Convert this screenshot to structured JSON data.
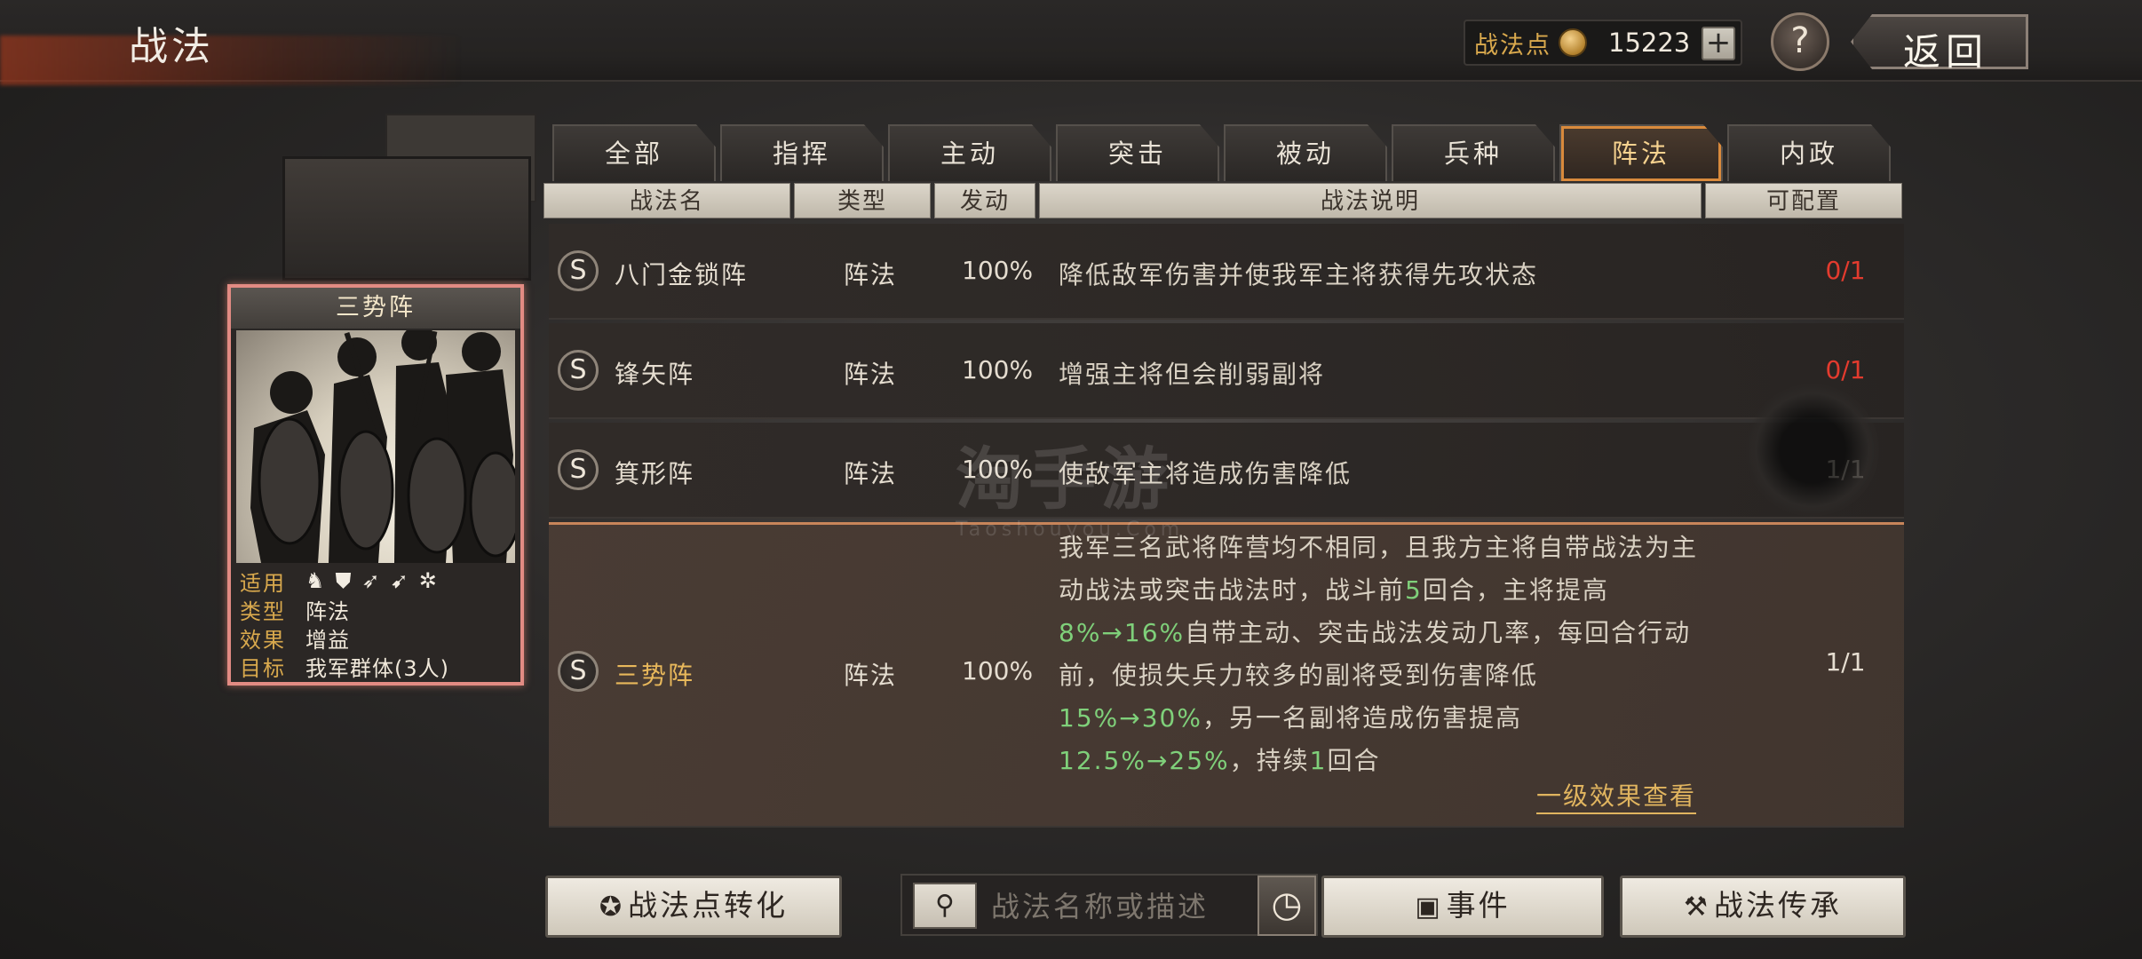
{
  "header": {
    "title": "战法",
    "points_label": "战法点",
    "points_value": "15223",
    "plus_label": "+",
    "help_label": "?",
    "back_label": "返回"
  },
  "card": {
    "name": "三势阵",
    "labels": {
      "apply": "适用",
      "type": "类型",
      "effect": "效果",
      "target": "目标"
    },
    "type": "阵法",
    "effect": "增益",
    "target": "我军群体(3人)",
    "troop_icons": [
      "cavalry-icon",
      "shield-icon",
      "bow-icon",
      "spear-icon",
      "vehicle-icon"
    ]
  },
  "tabs": [
    "全部",
    "指挥",
    "主动",
    "突击",
    "被动",
    "兵种",
    "阵法",
    "内政"
  ],
  "active_tab": "阵法",
  "table": {
    "headers": [
      "战法名",
      "类型",
      "发动",
      "战法说明",
      "可配置"
    ],
    "rows": [
      {
        "badge": "S",
        "name": "八门金锁阵",
        "type": "阵法",
        "rate": "100%",
        "desc": "降低敌军伤害并使我军主将获得先攻状态",
        "count": "0/1"
      },
      {
        "badge": "S",
        "name": "锋矢阵",
        "type": "阵法",
        "rate": "100%",
        "desc": "增强主将但会削弱副将",
        "count": "0/1"
      },
      {
        "badge": "S",
        "name": "箕形阵",
        "type": "阵法",
        "rate": "100%",
        "desc": "使敌军主将造成伤害降低",
        "count": "1/1"
      },
      {
        "badge": "S",
        "name": "三势阵",
        "type": "阵法",
        "rate": "100%",
        "count": "1/1",
        "desc_parts": [
          "我军三名武将阵营均不相同，且我方主将自带战法为主动战法或突击战法时，战斗前",
          "5",
          "回合，主将提高",
          "8%→16%",
          "自带主动、突击战法发动几率，每回合行动前，使损失兵力较多的副将受到伤害降低",
          "15%→30%",
          "，另一名副将造成伤害提高",
          "12.5%→25%",
          "，持续",
          "1",
          "回合"
        ],
        "link": "一级效果查看"
      }
    ]
  },
  "watermark": {
    "main": "淘手游",
    "sub": "Taoshouyou.Com"
  },
  "bottom": {
    "convert_label": "战法点转化",
    "search_placeholder": "战法名称或描述",
    "event_label": "事件",
    "inherit_label": "战法传承"
  },
  "colors": {
    "accent_gold": "#e8b85b",
    "count_red": "#e33b2e",
    "highlight_green": "#7fd07a",
    "tab_active_border": "#d98a3c"
  }
}
